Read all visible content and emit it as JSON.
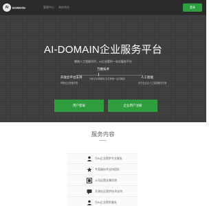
{
  "header": {
    "logo_mark": "AI",
    "logo_text": "DOMAIN",
    "nav": [
      "管理中心",
      "商务合作"
    ],
    "login_label": "登录"
  },
  "hero": {
    "title": "AI-DOMAIN企业服务平台",
    "subtitle": "拥抱人工智能时代，AI企业提供一站式服务平台",
    "features": {
      "center": {
        "title": "万维技术",
        "sub": "分布式计算服务  支付等第一站式服务"
      },
      "left": {
        "title": "开放云平台支持",
        "sub": "帮助企业快速开发"
      },
      "right": {
        "title": "人工智能",
        "sub": "多方位企业人工智能解决方案"
      }
    },
    "buttons": {
      "user": "用户登录",
      "corp": "企业用户注册"
    }
  },
  "services": {
    "title": "服务内容",
    "items": [
      {
        "icon": "user-icon",
        "label": "为AI企业提供专业服务"
      },
      {
        "icon": "star-icon",
        "label": "专家级技术支持团队"
      },
      {
        "icon": "grid-icon",
        "label": "公司运营支撑资源"
      },
      {
        "icon": "chat-icon",
        "label": "开源社区提供技术支持"
      },
      {
        "icon": "user-icon",
        "label": "为AI企业提供服务"
      }
    ]
  },
  "colors": {
    "accent": "#2e9e3e",
    "header_bg": "#2b2b2b",
    "hero_bg": "#3b3b3b"
  }
}
